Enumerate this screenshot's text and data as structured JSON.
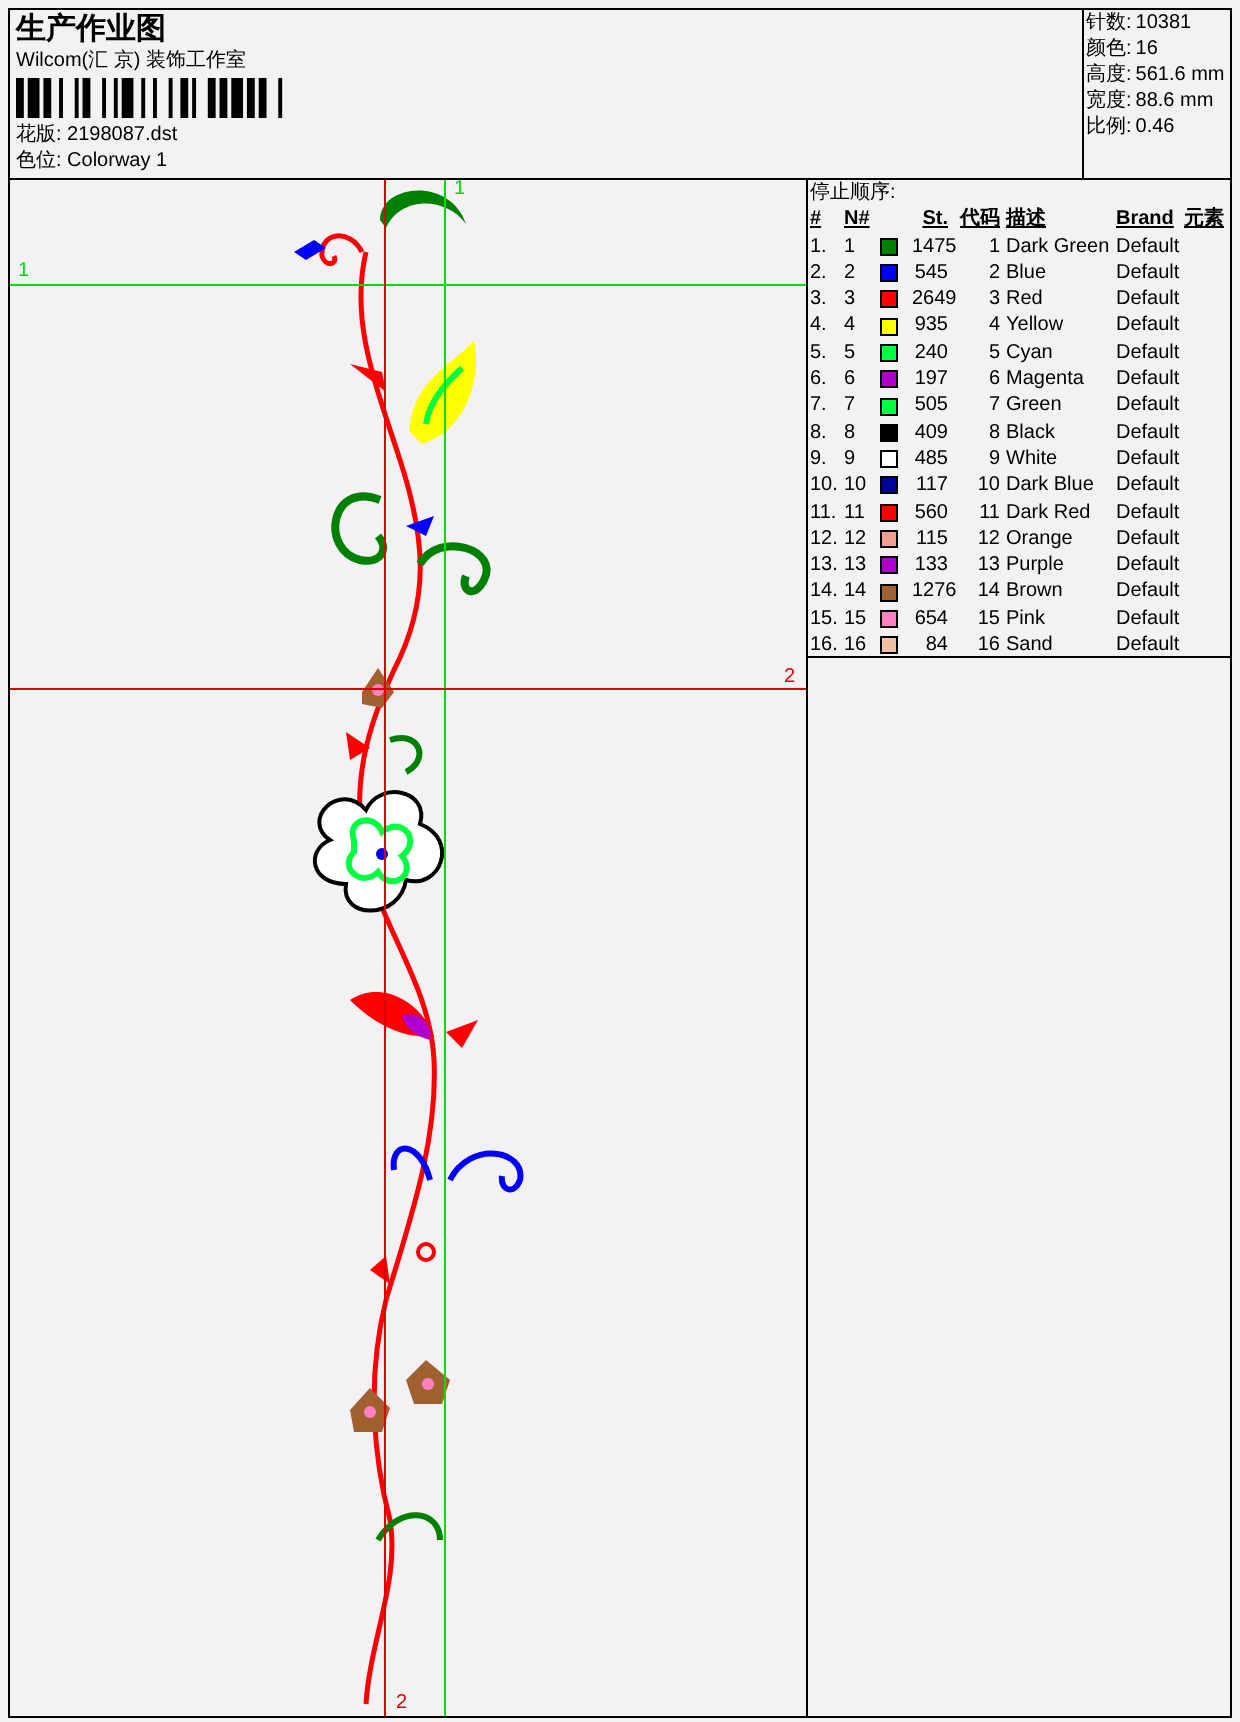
{
  "header": {
    "title": "生产作业图",
    "company": "Wilcom(汇 京) 装饰工作室",
    "design_file": "花版: 2198087.dst",
    "colorway": "色位: Colorway 1"
  },
  "info": [
    {
      "label": "针数:",
      "value": "10381"
    },
    {
      "label": "颜色:",
      "value": "16"
    },
    {
      "label": "高度:",
      "value": "561.6 mm"
    },
    {
      "label": "宽度:",
      "value": "88.6 mm"
    },
    {
      "label": "比例:",
      "value": "0.46"
    }
  ],
  "guides": [
    {
      "label": "1",
      "color": "#00e000",
      "kind": "vertical"
    },
    {
      "label": "1",
      "color": "#00e000",
      "kind": "horizontal"
    },
    {
      "label": "2",
      "color": "#e00000",
      "kind": "horizontal"
    },
    {
      "label": "2",
      "color": "#e00000",
      "kind": "vertical"
    }
  ],
  "stop_sequence": {
    "title": "停止顺序:",
    "columns": [
      "#",
      "N#",
      "St.",
      "代码",
      "描述",
      "Brand",
      "元素"
    ],
    "rows": [
      {
        "index": "1.",
        "number": "1",
        "color": "#008000",
        "stitches": "1475",
        "code": "1",
        "description": "Dark Green",
        "brand": "Default"
      },
      {
        "index": "2.",
        "number": "2",
        "color": "#0000ff",
        "stitches": "545",
        "code": "2",
        "description": "Blue",
        "brand": "Default"
      },
      {
        "index": "3.",
        "number": "3",
        "color": "#ff0000",
        "stitches": "2649",
        "code": "3",
        "description": "Red",
        "brand": "Default"
      },
      {
        "index": "4.",
        "number": "4",
        "color": "#ffff00",
        "stitches": "935",
        "code": "4",
        "description": "Yellow",
        "brand": "Default"
      },
      {
        "index": "5.",
        "number": "5",
        "color": "#00ff40",
        "stitches": "240",
        "code": "5",
        "description": "Cyan",
        "brand": "Default"
      },
      {
        "index": "6.",
        "number": "6",
        "color": "#b000d0",
        "stitches": "197",
        "code": "6",
        "description": "Magenta",
        "brand": "Default"
      },
      {
        "index": "7.",
        "number": "7",
        "color": "#00ff40",
        "stitches": "505",
        "code": "7",
        "description": "Green",
        "brand": "Default"
      },
      {
        "index": "8.",
        "number": "8",
        "color": "#000000",
        "stitches": "409",
        "code": "8",
        "description": "Black",
        "brand": "Default"
      },
      {
        "index": "9.",
        "number": "9",
        "color": "#ffffff",
        "stitches": "485",
        "code": "9",
        "description": "White",
        "brand": "Default"
      },
      {
        "index": "10.",
        "number": "10",
        "color": "#0000a0",
        "stitches": "117",
        "code": "10",
        "description": "Dark Blue",
        "brand": "Default"
      },
      {
        "index": "11.",
        "number": "11",
        "color": "#ff0000",
        "stitches": "560",
        "code": "11",
        "description": "Dark Red",
        "brand": "Default"
      },
      {
        "index": "12.",
        "number": "12",
        "color": "#f0a090",
        "stitches": "115",
        "code": "12",
        "description": "Orange",
        "brand": "Default"
      },
      {
        "index": "13.",
        "number": "13",
        "color": "#b000d0",
        "stitches": "133",
        "code": "13",
        "description": "Purple",
        "brand": "Default"
      },
      {
        "index": "14.",
        "number": "14",
        "color": "#a06030",
        "stitches": "1276",
        "code": "14",
        "description": "Brown",
        "brand": "Default"
      },
      {
        "index": "15.",
        "number": "15",
        "color": "#ff80c0",
        "stitches": "654",
        "code": "15",
        "description": "Pink",
        "brand": "Default"
      },
      {
        "index": "16.",
        "number": "16",
        "color": "#f0c0a0",
        "stitches": "84",
        "code": "16",
        "description": "Sand",
        "brand": "Default"
      }
    ]
  }
}
